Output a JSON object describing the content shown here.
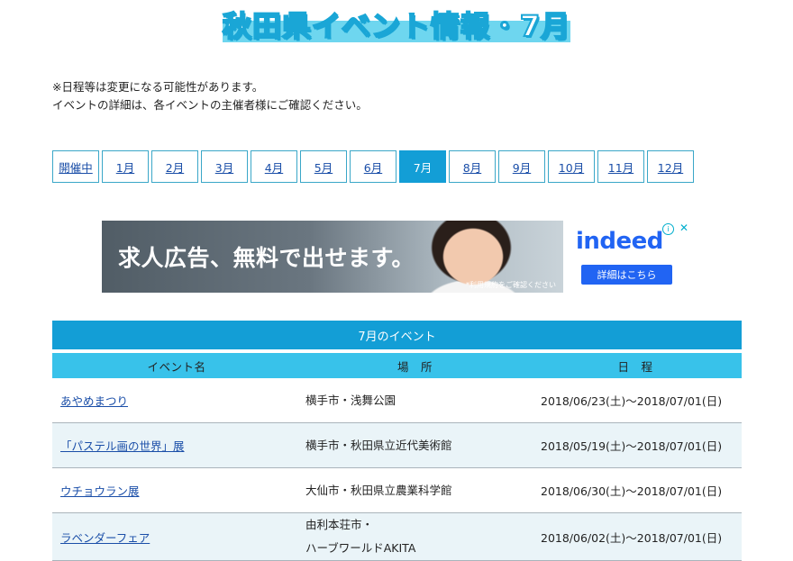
{
  "header": {
    "title": "秋田県イベント情報・7月"
  },
  "notice": {
    "line1": "※日程等は変更になる可能性があります。",
    "line2": "イベントの詳細は、各イベントの主催者様にご確認ください。"
  },
  "month_nav": {
    "items": [
      {
        "label": "開催中"
      },
      {
        "label": "1月"
      },
      {
        "label": "2月"
      },
      {
        "label": "3月"
      },
      {
        "label": "4月"
      },
      {
        "label": "5月"
      },
      {
        "label": "6月"
      },
      {
        "label": "7月",
        "active": true
      },
      {
        "label": "8月"
      },
      {
        "label": "9月"
      },
      {
        "label": "10月"
      },
      {
        "label": "11月"
      },
      {
        "label": "12月"
      }
    ]
  },
  "ad": {
    "headline": "求人広告、無料で出せます。",
    "note": "*利用規約をご確認ください",
    "brand": "indeed",
    "cta": "詳細はこちら",
    "info_icon": "info-icon",
    "close_icon": "close-icon"
  },
  "events": {
    "title": "7月のイベント",
    "columns": [
      "イベント名",
      "場　所",
      "日　程"
    ],
    "rows": [
      {
        "name": "あやめまつり",
        "place": [
          "横手市・浅舞公園"
        ],
        "date": "2018/06/23(土)～2018/07/01(日)"
      },
      {
        "name": "「パステル画の世界」展",
        "place": [
          "横手市・秋田県立近代美術館"
        ],
        "date": "2018/05/19(土)～2018/07/01(日)"
      },
      {
        "name": "ウチョウラン展",
        "place": [
          "大仙市・秋田県立農業科学館"
        ],
        "date": "2018/06/30(土)～2018/07/01(日)"
      },
      {
        "name": "ラベンダーフェア",
        "place": [
          "由利本荘市・",
          "ハーブワールドAKITA"
        ],
        "date": "2018/06/02(土)～2018/07/01(日)"
      }
    ]
  },
  "colors": {
    "accent": "#139ed6",
    "header_row": "#38c2ea",
    "link": "#1a4ea8",
    "indeed_blue": "#2164f3"
  }
}
